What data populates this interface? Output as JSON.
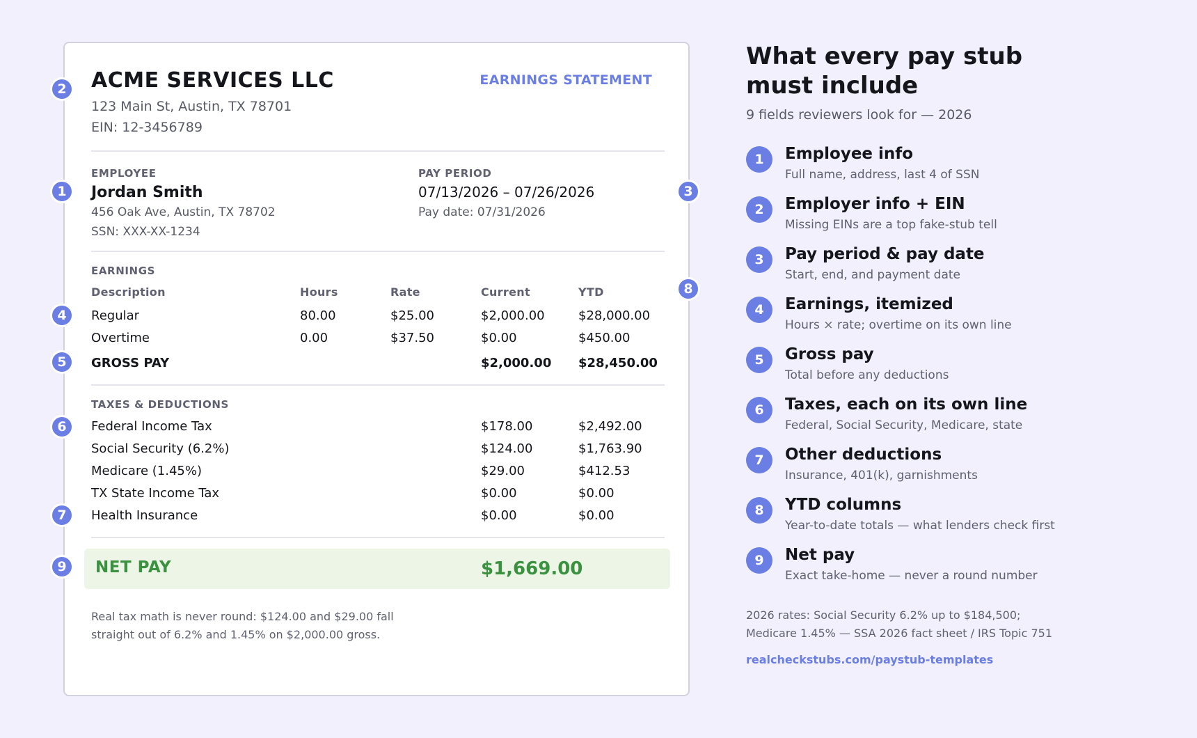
{
  "stub": {
    "company": "ACME SERVICES LLC",
    "address": "123 Main St, Austin, TX 78701",
    "ein": "EIN: 12-3456789",
    "statement_label": "EARNINGS STATEMENT",
    "employee_label": "EMPLOYEE",
    "employee_name": "Jordan Smith",
    "employee_address": "456 Oak Ave, Austin, TX 78702",
    "employee_ssn": "SSN: XXX-XX-1234",
    "pay_period_label": "PAY PERIOD",
    "pay_period": "07/13/2026 – 07/26/2026",
    "pay_date": "Pay date: 07/31/2026",
    "earnings_label": "EARNINGS",
    "columns": [
      "Description",
      "Hours",
      "Rate",
      "Current",
      "YTD"
    ],
    "earnings": [
      {
        "desc": "Regular",
        "hours": "80.00",
        "rate": "$25.00",
        "current": "$2,000.00",
        "ytd": "$28,000.00"
      },
      {
        "desc": "Overtime",
        "hours": "0.00",
        "rate": "$37.50",
        "current": "$0.00",
        "ytd": "$450.00"
      }
    ],
    "gross": {
      "label": "GROSS PAY",
      "current": "$2,000.00",
      "ytd": "$28,450.00"
    },
    "deductions_label": "TAXES & DEDUCTIONS",
    "deductions": [
      {
        "desc": "Federal Income Tax",
        "current": "$178.00",
        "ytd": "$2,492.00"
      },
      {
        "desc": "Social Security (6.2%)",
        "current": "$124.00",
        "ytd": "$1,763.90"
      },
      {
        "desc": "Medicare (1.45%)",
        "current": "$29.00",
        "ytd": "$412.53"
      },
      {
        "desc": "TX State Income Tax",
        "current": "$0.00",
        "ytd": "$0.00"
      },
      {
        "desc": "Health Insurance",
        "current": "$0.00",
        "ytd": "$0.00"
      }
    ],
    "net": {
      "label": "NET PAY",
      "value": "$1,669.00"
    },
    "note_lines": [
      "Real tax math is never round: $124.00 and $29.00 fall",
      "straight out of 6.2% and 1.45% on $2,000.00 gross."
    ]
  },
  "markers": [
    "1",
    "2",
    "3",
    "4",
    "5",
    "6",
    "7",
    "8",
    "9"
  ],
  "panel": {
    "title": "What every pay stub must include",
    "subtitle": "9 fields reviewers look for — 2026",
    "fields": [
      {
        "num": "1",
        "title": "Employee info",
        "desc": "Full name, address, last 4 of SSN"
      },
      {
        "num": "2",
        "title": "Employer info + EIN",
        "desc": "Missing EINs are a top fake-stub tell"
      },
      {
        "num": "3",
        "title": "Pay period & pay date",
        "desc": "Start, end, and payment date"
      },
      {
        "num": "4",
        "title": "Earnings, itemized",
        "desc": "Hours × rate; overtime on its own line"
      },
      {
        "num": "5",
        "title": "Gross pay",
        "desc": "Total before any deductions"
      },
      {
        "num": "6",
        "title": "Taxes, each on its own line",
        "desc": "Federal, Social Security, Medicare, state"
      },
      {
        "num": "7",
        "title": "Other deductions",
        "desc": "Insurance, 401(k), garnishments"
      },
      {
        "num": "8",
        "title": "YTD columns",
        "desc": "Year-to-date totals — what lenders check first"
      },
      {
        "num": "9",
        "title": "Net pay",
        "desc": "Exact take-home — never a round number"
      }
    ],
    "footnote_lines": [
      "2026 rates: Social Security 6.2% up to $184,500;",
      "Medicare 1.45% — SSA 2026 fact sheet / IRS Topic 751"
    ],
    "link": "realcheckstubs.com/paystub-templates"
  },
  "colors": {
    "accent": "#6b7ee3",
    "net_pay_green": "#3a9140",
    "net_pay_bg": "#edf5e7",
    "page_bg": "#f1f0fc"
  }
}
